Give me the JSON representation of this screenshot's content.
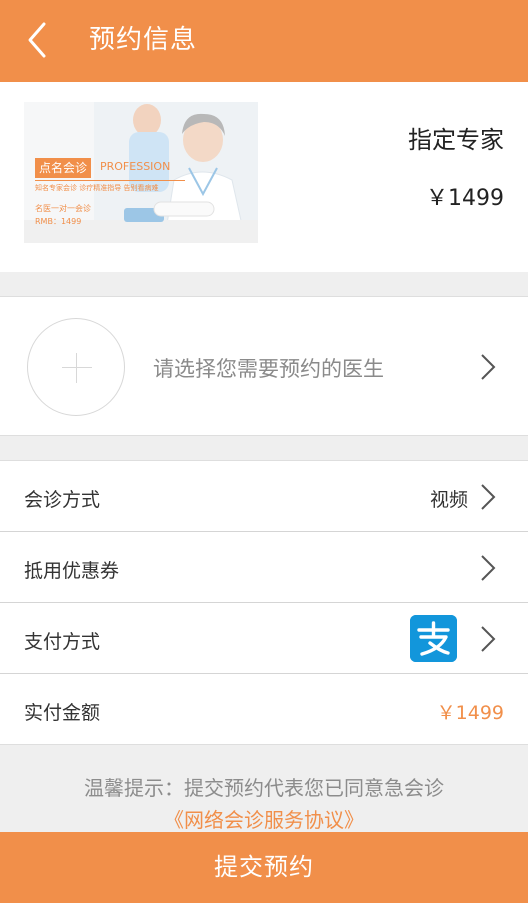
{
  "header": {
    "title": "预约信息"
  },
  "product": {
    "name": "指定专家",
    "price": "￥1499",
    "banner": {
      "badge": "点名会诊",
      "badge_en": "PROFESSION",
      "subline": "知名专家会诊  诊疗精准指导  告别看病难",
      "line1": "名医一对一会诊",
      "line2": "RMB：1499"
    }
  },
  "doctor_select": {
    "placeholder": "请选择您需要预约的医生"
  },
  "rows": {
    "consult": {
      "label": "会诊方式",
      "value": "视频"
    },
    "coupon": {
      "label": "抵用优惠券"
    },
    "payment": {
      "label": "支付方式",
      "icon": "alipay-icon",
      "icon_glyph": "支"
    },
    "amount": {
      "label": "实付金额",
      "value": "￥1499"
    }
  },
  "tip": {
    "text": "温馨提示：提交预约代表您已同意急会诊",
    "agreement": "《网络会诊服务协议》"
  },
  "submit": {
    "label": "提交预约"
  },
  "colors": {
    "accent": "#f18f4a",
    "alipay": "#1296db"
  }
}
